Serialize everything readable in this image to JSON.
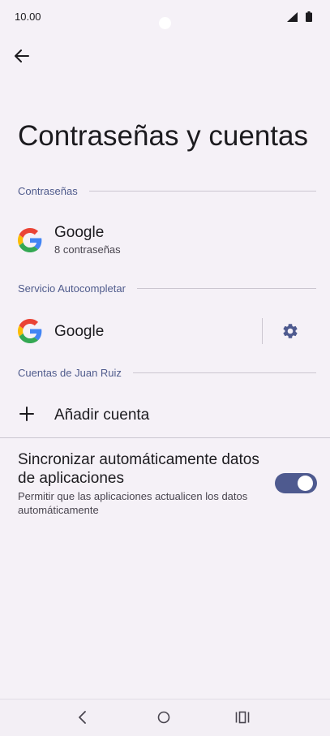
{
  "status_bar": {
    "time": "10.00"
  },
  "page": {
    "title": "Contraseñas y cuentas"
  },
  "sections": {
    "passwords": {
      "header": "Contraseñas",
      "item": {
        "title": "Google",
        "subtitle": "8 contraseñas"
      }
    },
    "autofill": {
      "header": "Servicio Autocompletar",
      "item": {
        "title": "Google"
      }
    },
    "accounts": {
      "header": "Cuentas de Juan Ruiz",
      "add_label": "Añadir cuenta"
    }
  },
  "sync": {
    "title": "Sincronizar automáticamente datos de aplicaciones",
    "subtitle": "Permitir que las aplicaciones actualicen los datos automáticamente",
    "enabled": true
  },
  "colors": {
    "accent": "#4e5a8f",
    "section_header": "#4f5b8c",
    "background": "#f5f1f7"
  },
  "icons": [
    "back-arrow-icon",
    "google-icon",
    "gear-icon",
    "plus-icon",
    "nav-back-icon",
    "nav-home-icon",
    "nav-recents-icon",
    "signal-icon",
    "battery-icon"
  ]
}
